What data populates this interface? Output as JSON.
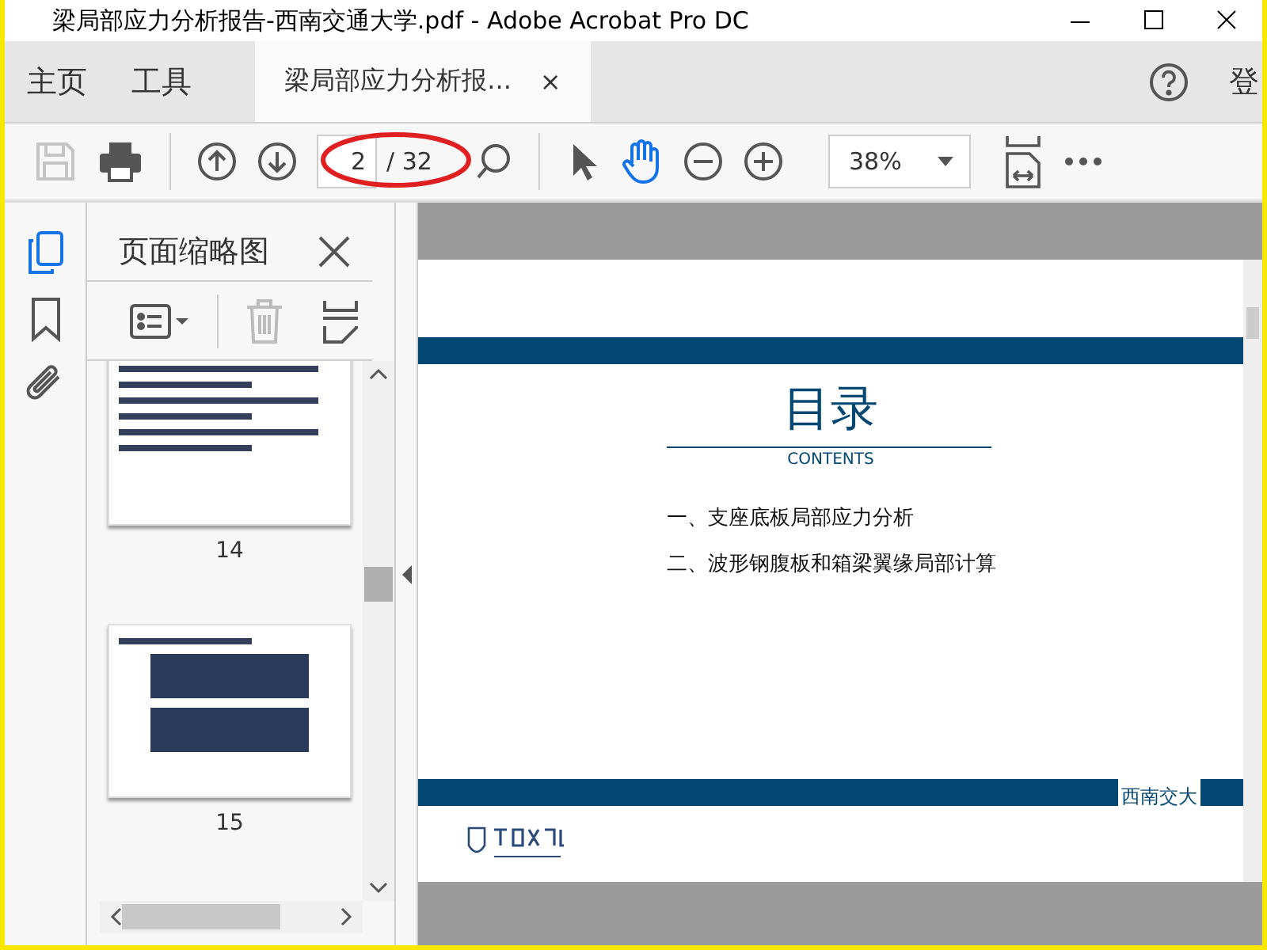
{
  "window": {
    "title": "梁局部应力分析报告-西南交通大学.pdf - Adobe Acrobat Pro DC"
  },
  "tabs": [
    {
      "label": "主页",
      "selected": false
    },
    {
      "label": "工具",
      "selected": false
    },
    {
      "label": "梁局部应力分析报...",
      "selected": true,
      "close": "×"
    }
  ],
  "sign_in": "登",
  "toolbar": {
    "save": {
      "disabled": true
    },
    "page_field": {
      "value": "2",
      "total": "/ 32"
    },
    "select_tool": {
      "selected": false
    },
    "hand_tool": {
      "selected": true
    },
    "zoom": {
      "value": "38%"
    }
  },
  "rail": [
    {
      "kind": "pages",
      "selected": true
    },
    {
      "kind": "bookmarks",
      "selected": false
    },
    {
      "kind": "attachments",
      "selected": false
    }
  ],
  "panel": {
    "title": "页面缩略图",
    "thumbnails": [
      {
        "page": "14",
        "kind": "text",
        "selected": false
      },
      {
        "page": "15",
        "kind": "images",
        "selected": false
      }
    ]
  },
  "slide": {
    "title": "目录",
    "subtitle": "CONTENTS",
    "items": [
      "一、支座底板局部应力分析",
      "二、波形钢腹板和箱梁翼缘局部计算"
    ],
    "footer": "西南交大"
  }
}
